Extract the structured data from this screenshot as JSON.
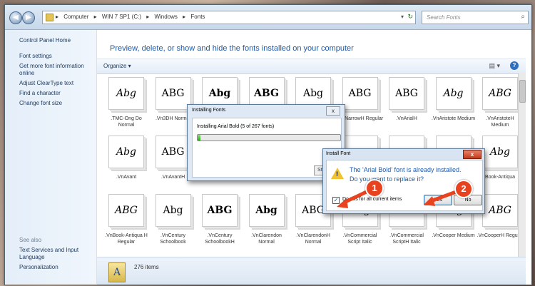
{
  "address_bar": {
    "crumbs": [
      "Computer",
      "WIN 7 SP1 (C:)",
      "Windows",
      "Fonts"
    ],
    "search_placeholder": "Search Fonts"
  },
  "sidebar": {
    "items": [
      {
        "label": "Control Panel Home"
      },
      {
        "label": "Font settings"
      },
      {
        "label": "Get more font information online"
      },
      {
        "label": "Adjust ClearType text"
      },
      {
        "label": "Find a character"
      },
      {
        "label": "Change font size"
      }
    ],
    "see_also_title": "See also",
    "see_also_items": [
      {
        "label": "Text Services and Input Language"
      },
      {
        "label": "Personalization"
      }
    ]
  },
  "main": {
    "heading": "Preview, delete, or show and hide the fonts installed on your computer",
    "organize_label": "Organize ▾",
    "fonts": [
      {
        "preview": "Abg",
        "name": ".TMC-Ong Do Normal"
      },
      {
        "preview": "ABG",
        "name": ".Vn3DH Normal"
      },
      {
        "preview": "Abg",
        "name": ""
      },
      {
        "preview": "ABG",
        "name": ""
      },
      {
        "preview": "Abg",
        "name": ""
      },
      {
        "preview": "ABG",
        "name": "rial NarrowH Regular"
      },
      {
        "preview": "ABG",
        "name": ".VnArialH"
      },
      {
        "preview": "Abg",
        "name": ".VnAristote Medium"
      },
      {
        "preview": "ABG",
        "name": ".VnAristoteH Medium"
      },
      {
        "preview": "Abg",
        "name": ".VnAvant"
      },
      {
        "preview": "ABG",
        "name": ".VnAvantH"
      },
      {
        "preview": "",
        "name": "Bold"
      },
      {
        "preview": "",
        "name": "Bold"
      },
      {
        "preview": "",
        "name": ""
      },
      {
        "preview": "",
        "name": ""
      },
      {
        "preview": "",
        "name": ""
      },
      {
        "preview": "",
        "name": ""
      },
      {
        "preview": "Abg",
        "name": "Book-Antiqua"
      },
      {
        "preview": "ABG",
        "name": ".VnBook-Antiqua H Regular"
      },
      {
        "preview": "Abg",
        "name": ".VnCentury Schoolbook"
      },
      {
        "preview": "ABG",
        "name": ".VnCentury SchoolbookH"
      },
      {
        "preview": "Abg",
        "name": ".VnClarendon Normal"
      },
      {
        "preview": "ABG",
        "name": ".VnClarendonH Normal"
      },
      {
        "preview": "Abg",
        "name": ".VnCommercial Script Italic"
      },
      {
        "preview": "ABG",
        "name": ".VnCommercial ScriptH Italic"
      },
      {
        "preview": "Abg",
        "name": ".VnCooper Medium"
      },
      {
        "preview": "ABG",
        "name": ".VnCooperH Regular"
      }
    ],
    "item_count": "276 items"
  },
  "installing_dialog": {
    "title": "Installing Fonts",
    "close": "x",
    "message": "Installing Arial Bold (5 of 267 fonts)",
    "progress": 0.02,
    "stop_label": "St"
  },
  "install_font_dialog": {
    "title": "Install Font",
    "close": "x",
    "message_line1": "The 'Arial Bold' font is already installed.",
    "message_line2": "Do you want to replace it?",
    "checkbox_label": "Do this for all current items",
    "checkbox_checked": true,
    "yes_label": "Yes",
    "no_label": "No"
  },
  "annotations": {
    "badge1": "1",
    "badge2": "2",
    "color": "#e8421e"
  },
  "colors": {
    "link": "#1e395b",
    "heading": "#1e5aa8"
  }
}
